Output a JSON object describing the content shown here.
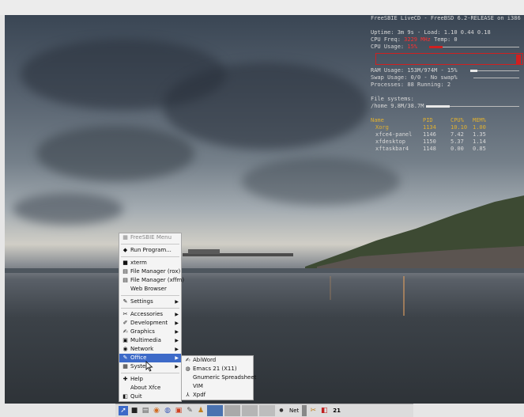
{
  "conky": {
    "header_left": "FreeSBIE LiveCD",
    "header_right": "FreeBSD 6.2-RELEASE on i386",
    "uptime": "Uptime: 3m 9s",
    "load": "Load: 1.10 0.44 0.18",
    "cpu_freq_label": "CPU Freq:",
    "cpu_freq_value": "3229 MHz",
    "temp": "Temp: 0",
    "cpu_usage_label": "CPU Usage:",
    "cpu_usage_value": "15%",
    "cpu_usage_pct": 15,
    "ram": "RAM Usage: 153M/974M - 15%",
    "ram_pct": 15,
    "swap": "Swap Usage: 0/0 - No swap%",
    "processes": "Processes: 88  Running: 2",
    "fs_title": "File systems:",
    "fs_root": "/home 9.8M/38.7M",
    "fs_pct": 25,
    "table_headers": [
      "Name",
      "PID",
      "CPU%",
      "MEM%"
    ],
    "processes_list": [
      [
        "Xorg",
        "1134",
        "10.10",
        "1.00"
      ],
      [
        "xfce4-panel",
        "1146",
        "7.42",
        "1.35"
      ],
      [
        "xfdesktop",
        "1150",
        "5.37",
        "1.14"
      ],
      [
        "xftaskbar4",
        "1148",
        "0.00",
        "0.85"
      ]
    ]
  },
  "menu": {
    "title": "FreeSBIE Menu",
    "items": [
      {
        "label": "Run Program...",
        "icon": "run-icon",
        "glyph": "◆"
      },
      {
        "sep": true
      },
      {
        "label": "xterm",
        "icon": "terminal-icon",
        "glyph": "■"
      },
      {
        "label": "File Manager (rox)",
        "icon": "file-icon",
        "glyph": "▤"
      },
      {
        "label": "File Manager (xffm)",
        "icon": "file-icon",
        "glyph": "▤"
      },
      {
        "label": "Web Browser",
        "icon": "browser-icon",
        "glyph": ""
      },
      {
        "sep": true
      },
      {
        "label": "Settings",
        "icon": "settings-icon",
        "glyph": "✎",
        "arrow": true
      },
      {
        "sep": true
      },
      {
        "label": "Accessories",
        "icon": "accessories-icon",
        "glyph": "✂",
        "arrow": true
      },
      {
        "label": "Development",
        "icon": "development-icon",
        "glyph": "✐",
        "arrow": true
      },
      {
        "label": "Graphics",
        "icon": "graphics-icon",
        "glyph": "✍",
        "arrow": true
      },
      {
        "label": "Multimedia",
        "icon": "multimedia-icon",
        "glyph": "▣",
        "arrow": true
      },
      {
        "label": "Network",
        "icon": "network-icon",
        "glyph": "◉",
        "arrow": true
      },
      {
        "label": "Office",
        "icon": "office-icon",
        "glyph": "✎",
        "arrow": true,
        "selected": true
      },
      {
        "label": "System",
        "icon": "system-icon",
        "glyph": "▦",
        "arrow": true
      },
      {
        "sep": true
      },
      {
        "label": "Help",
        "icon": "help-icon",
        "glyph": "✚"
      },
      {
        "label": "About Xfce",
        "icon": "about-icon",
        "glyph": ""
      },
      {
        "label": "Quit",
        "icon": "quit-icon",
        "glyph": "◧"
      }
    ]
  },
  "submenu": {
    "items": [
      {
        "label": "AbiWord",
        "icon": "abiword-icon",
        "glyph": "✍"
      },
      {
        "label": "Emacs 21 (X11)",
        "icon": "emacs-icon",
        "glyph": "◍"
      },
      {
        "label": "Gnumeric Spreadsheet",
        "icon": "gnumeric-icon",
        "glyph": ""
      },
      {
        "label": "VIM",
        "icon": "vim-icon",
        "glyph": ""
      },
      {
        "label": "Xpdf",
        "icon": "xpdf-icon",
        "glyph": "⅄"
      }
    ]
  },
  "panel": {
    "net_label": "Net",
    "clock": "21"
  },
  "colors": {
    "menu_selected": "#3d6ac8",
    "conky_highlight": "#ff3030",
    "conky_header": "#e0b030"
  }
}
